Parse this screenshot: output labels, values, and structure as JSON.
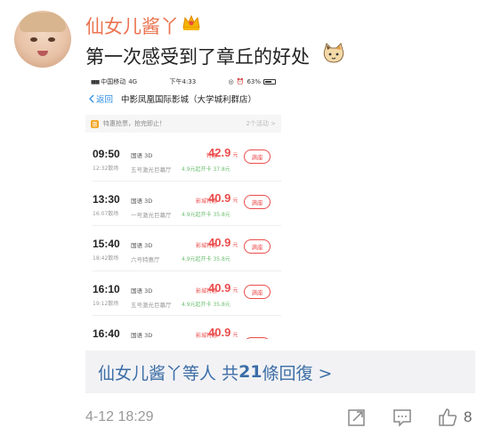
{
  "post": {
    "username": "仙女儿酱丫",
    "text": "第一次感受到了章丘的好处",
    "time": "4-12 18:29",
    "like_count": "8"
  },
  "screenshot": {
    "status": {
      "carrier": "中国移动",
      "network": "4G",
      "time": "下午4:33",
      "battery": "63%"
    },
    "nav": {
      "back": "返回",
      "title": "中影凤凰国际影城（大学城利群店）"
    },
    "promo": {
      "tag": "惠",
      "text": "特惠抢票，抢完即止！",
      "more": "2个活动 >"
    },
    "showtimes": [
      {
        "time": "09:50",
        "end": "12:32散场",
        "lang": "国语 3D",
        "hall": "五号激光巨幕厅",
        "label": "特惠",
        "price": "42.9",
        "unit": "元",
        "note": "4.9元起开卡 37.8元",
        "button": "满座"
      },
      {
        "time": "13:30",
        "end": "16:07散场",
        "lang": "国语 3D",
        "hall": "一号激光巨幕厅",
        "label": "影城特惠",
        "price": "40.9",
        "unit": "元",
        "note": "4.9元起开卡 35.8元",
        "button": "满座"
      },
      {
        "time": "15:40",
        "end": "18:42散场",
        "lang": "国语 3D",
        "hall": "六号特惠厅",
        "label": "影城特惠",
        "price": "40.9",
        "unit": "元",
        "note": "4.9元起开卡 35.8元",
        "button": "满座"
      },
      {
        "time": "16:10",
        "end": "19:12散场",
        "lang": "国语 3D",
        "hall": "五号激光巨幕厅",
        "label": "影城特惠",
        "price": "40.9",
        "unit": "元",
        "note": "4.9元起开卡 35.8元",
        "button": "满座"
      },
      {
        "time": "16:40",
        "end": "",
        "lang": "国语 3D",
        "hall": "",
        "label": "影城特惠",
        "price": "40.9",
        "unit": "元",
        "note": "",
        "button": ""
      }
    ]
  },
  "replies": {
    "name": "仙女儿酱丫",
    "middle": "等人 共",
    "count": "21",
    "suffix": "條回復 >"
  },
  "colors": {
    "username": "#eb7350",
    "link": "#3c6ea6",
    "price": "#ec4d4d",
    "meta": "#999999"
  },
  "icons": [
    "crown-icon",
    "cat-emoji-icon",
    "forward-icon",
    "comment-icon",
    "like-icon"
  ]
}
